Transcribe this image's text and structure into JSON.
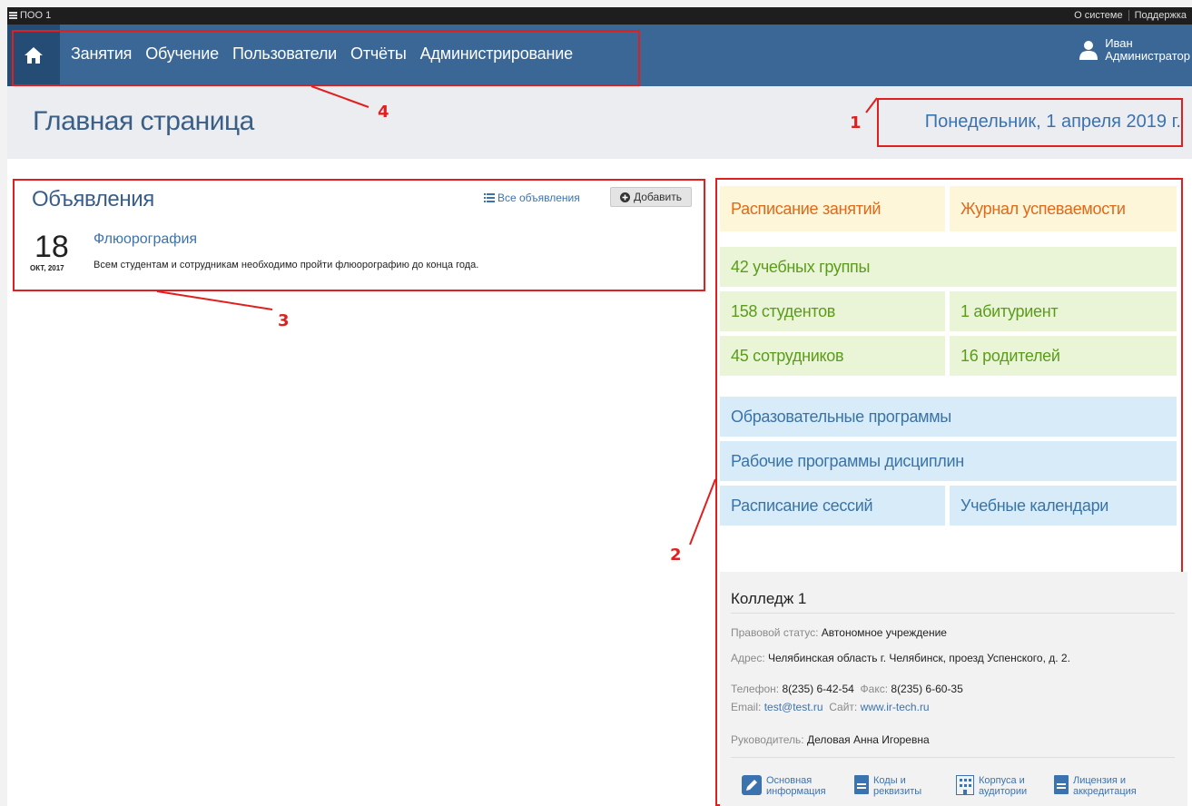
{
  "topbar": {
    "brand": "ПОО 1",
    "links": [
      "О системе",
      "Поддержка"
    ]
  },
  "nav": {
    "home_icon": "home-icon",
    "items": [
      "Занятия",
      "Обучение",
      "Пользователи",
      "Отчёты",
      "Администрирование"
    ],
    "user": {
      "first": "Иван",
      "role": "Администратор",
      "icon": "user-icon"
    }
  },
  "header": {
    "title": "Главная страница",
    "date": "Понедельник, 1 апреля 2019 г."
  },
  "annotations": [
    "1",
    "2",
    "3",
    "4"
  ],
  "announcements": {
    "title": "Объявления",
    "all_label": "Все объявления",
    "add_label": "Добавить",
    "items": [
      {
        "day": "18",
        "month_year": "ОКТ, 2017",
        "title": "Флюорография",
        "text": "Всем студентам и сотрудникам необходимо пройти флюорографию до конца года."
      }
    ]
  },
  "tiles": {
    "schedule": "Расписание занятий",
    "journal": "Журнал успеваемости",
    "groups": "42 учебных группы",
    "students": "158 студентов",
    "applicants": "1 абитуриент",
    "staff": "45 сотрудников",
    "parents": "16 родителей",
    "edu_programs": "Образовательные программы",
    "work_programs": "Рабочие программы дисциплин",
    "sessions": "Расписание сессий",
    "calendars": "Учебные календари"
  },
  "college": {
    "name": "Колледж 1",
    "legal_label": "Правовой статус:",
    "legal_value": "Автономное учреждение",
    "address_label": "Адрес:",
    "address_value": "Челябинская область г. Челябинск, проезд Успенского, д. 2.",
    "phone_label": "Телефон:",
    "phone_value": "8(235) 6-42-54",
    "fax_label": "Факс:",
    "fax_value": "8(235) 6-60-35",
    "email_label": "Email:",
    "email_value": "test@test.ru",
    "site_label": "Сайт:",
    "site_value": "www.ir-tech.ru",
    "head_label": "Руководитель:",
    "head_value": "Деловая Анна Игоревна",
    "links": [
      {
        "l1": "Основная",
        "l2": "информация",
        "icon": "pencil-icon"
      },
      {
        "l1": "Коды и",
        "l2": "реквизиты",
        "icon": "document-icon"
      },
      {
        "l1": "Корпуса и",
        "l2": "аудитории",
        "icon": "building-icon"
      },
      {
        "l1": "Лицензия и",
        "l2": "аккредитация",
        "icon": "document-icon"
      }
    ]
  },
  "colors": {
    "nav": "#3a6796",
    "nav_home": "#254c74",
    "annotation": "#e02020",
    "tile_yellow": "#fdf6d8",
    "tile_green": "#e9f5d6",
    "tile_blue": "#d7ecf8"
  }
}
